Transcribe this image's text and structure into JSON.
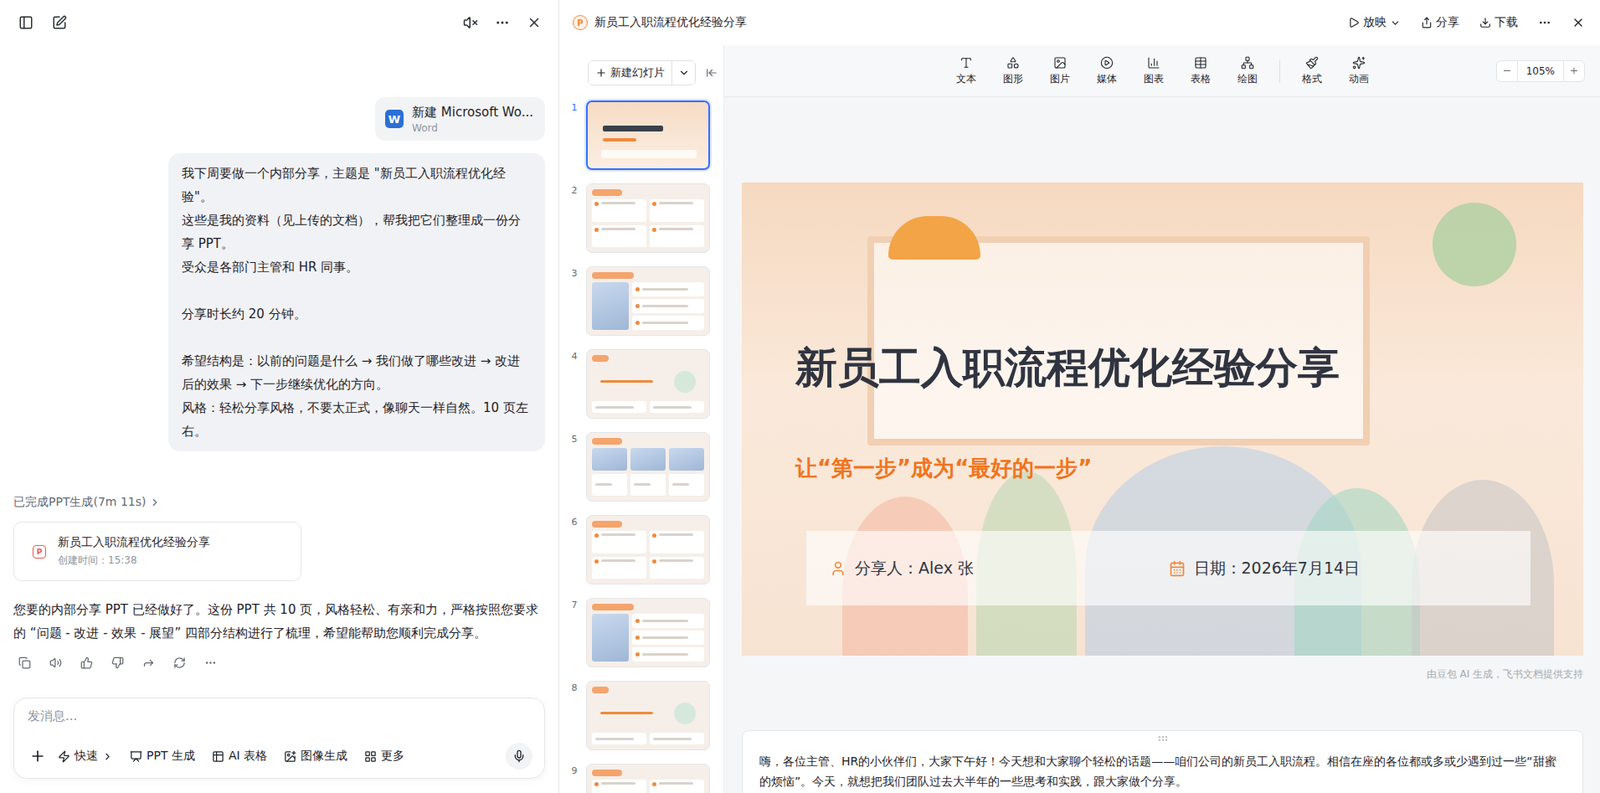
{
  "chat": {
    "attachment": {
      "icon": "W",
      "name": "新建 Microsoft Wo...",
      "type": "Word"
    },
    "userMessage": [
      [
        "我下周要做一个内部分享，主题是 \"新员工入职流程优化经验\"。",
        "这些是我的资料（见上传的文档），帮我把它们整理成一份分享 PPT。",
        "受众是各部门主管和 HR 同事。"
      ],
      [
        "分享时长约 20 分钟。"
      ],
      [
        "希望结构是：以前的问题是什么 → 我们做了哪些改进 → 改进后的效果 → 下一步继续优化的方向。",
        "风格：轻松分享风格，不要太正式，像聊天一样自然。10 页左右。"
      ]
    ],
    "status": "已完成PPT生成(7m 11s)",
    "fileCard": {
      "icon": "P",
      "title": "新员工入职流程优化经验分享",
      "time": "创建时间：15:38"
    },
    "reply": "您要的内部分享 PPT 已经做好了。这份 PPT 共 10 页，风格轻松、有亲和力，严格按照您要求的 “问题 - 改进 - 效果 - 展望” 四部分结构进行了梳理，希望能帮助您顺利完成分享。",
    "input": {
      "placeholder": "发消息...",
      "tools": [
        {
          "label": "快速",
          "kind": "menu"
        },
        {
          "label": "PPT 生成",
          "kind": "tool"
        },
        {
          "label": "AI 表格",
          "kind": "tool"
        },
        {
          "label": "图像生成",
          "kind": "tool"
        },
        {
          "label": "更多",
          "kind": "tool"
        }
      ]
    }
  },
  "document": {
    "icon": "P",
    "title": "新员工入职流程优化经验分享",
    "actions": [
      {
        "label": "放映",
        "kind": "menu"
      },
      {
        "label": "分享",
        "kind": "button"
      },
      {
        "label": "下载",
        "kind": "button"
      }
    ]
  },
  "slidesPanel": {
    "newButton": "新建幻灯片",
    "thumbnails": [
      {
        "number": "1",
        "kind": "cover",
        "selected": true
      },
      {
        "number": "2",
        "kind": "cards",
        "selected": false
      },
      {
        "number": "3",
        "kind": "media",
        "selected": false
      },
      {
        "number": "4",
        "kind": "section",
        "selected": false
      },
      {
        "number": "5",
        "kind": "gallery",
        "selected": false
      },
      {
        "number": "6",
        "kind": "cards",
        "selected": false
      },
      {
        "number": "7",
        "kind": "media",
        "selected": false
      },
      {
        "number": "8",
        "kind": "section",
        "selected": false
      },
      {
        "number": "9",
        "kind": "cards",
        "selected": false
      }
    ]
  },
  "toolbar": {
    "insertTools": [
      {
        "label": "文本"
      },
      {
        "label": "图形"
      },
      {
        "label": "图片"
      },
      {
        "label": "媒体"
      },
      {
        "label": "图表"
      },
      {
        "label": "表格"
      },
      {
        "label": "绘图"
      }
    ],
    "formatTools": [
      {
        "label": "格式"
      },
      {
        "label": "动画"
      }
    ],
    "zoom": "105%"
  },
  "slide": {
    "title": "新员工入职流程优化经验分享",
    "subtitle": "让“第一步”成为“最好的一步”",
    "presenter": "分享人：Alex 张",
    "date": "日期：2026年7月14日"
  },
  "credit": "由豆包 AI 生成，飞书文档提供支持",
  "notes": "嗨，各位主管、HR的小伙伴们，大家下午好！今天想和大家聊个轻松的话题——咱们公司的新员工入职流程。相信在座的各位都或多或少遇到过一些“甜蜜的烦恼”。今天，就想把我们团队过去大半年的一些思考和实践，跟大家做个分享。"
}
